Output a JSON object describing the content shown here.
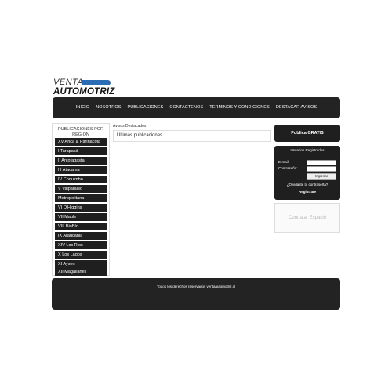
{
  "logo": {
    "line1": "VENTA",
    "line2": "AUTOMOTRIZ",
    "bar_color": "#2a6db5"
  },
  "nav": {
    "items": [
      {
        "label": "INICIO"
      },
      {
        "label": "NOSOTROS"
      },
      {
        "label": "PUBLICACIONES"
      },
      {
        "label": "CONTACTENOS"
      },
      {
        "label": "TERMINOS Y CONDICIONES"
      },
      {
        "label": "DESTACAR AVISOS"
      }
    ]
  },
  "sidebar": {
    "title": "PUBLICACIONES POR REGION",
    "regions": [
      {
        "label": "XV Arica & Parinacota"
      },
      {
        "label": "I Tarapacá"
      },
      {
        "label": "II Antofagasta"
      },
      {
        "label": "III Atacama"
      },
      {
        "label": "IV Coquimbo"
      },
      {
        "label": "V Valparaíso"
      },
      {
        "label": "Metropolitana"
      },
      {
        "label": "VI O'Higgins"
      },
      {
        "label": "VII Maule"
      },
      {
        "label": "VIII BioBío"
      },
      {
        "label": "IX Araucania"
      },
      {
        "label": "XIV Los Rios"
      },
      {
        "label": "X Los Lagos"
      },
      {
        "label": "XI Aysen"
      },
      {
        "label": "XII Magallanes"
      }
    ]
  },
  "main": {
    "featured_label": "Avisos Destacados",
    "latest_label": "Ultimas publicaciones"
  },
  "right": {
    "publish_button": "Publica GRATIS",
    "login": {
      "title": "Usuarios Registrados",
      "email_label": "E-mail:",
      "email_value": "",
      "password_label": "Contraseña:",
      "password_value": "",
      "submit_label": "Ingresar",
      "forgot_label": "¿Olvidaste tu contraseña?",
      "register_label": "Registrate"
    },
    "ad_space": "Contratar Espacio"
  },
  "footer": {
    "text": "Todos los derechos reservados ventaautomotriz.cl"
  },
  "colors": {
    "dark": "#232323",
    "accent": "#2a6db5"
  }
}
